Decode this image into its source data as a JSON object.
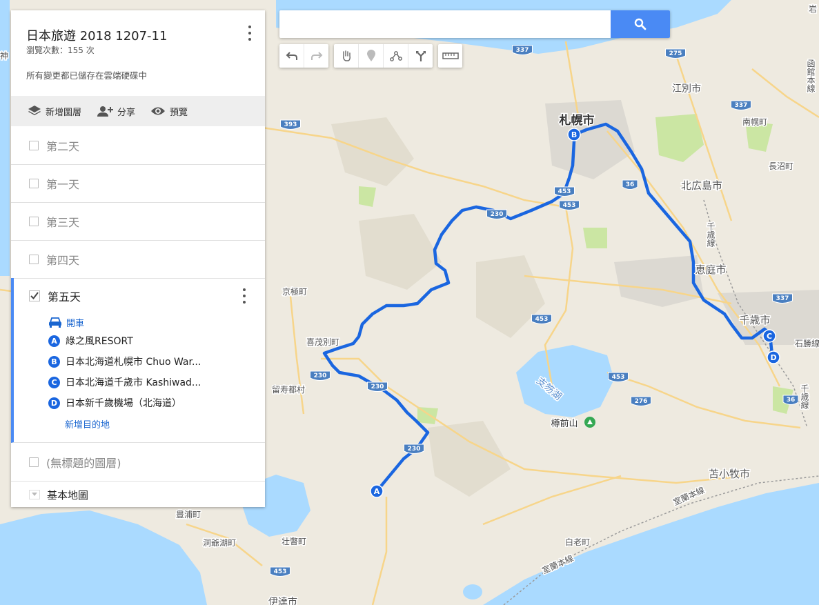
{
  "search": {
    "placeholder": "",
    "value": ""
  },
  "toolbar": {
    "tools": [
      {
        "icon": "undo-icon"
      },
      {
        "icon": "redo-icon"
      },
      {
        "icon": "hand-icon"
      },
      {
        "icon": "marker-icon"
      },
      {
        "icon": "draw-line-icon"
      },
      {
        "icon": "directions-icon"
      },
      {
        "icon": "ruler-icon"
      }
    ]
  },
  "panel": {
    "title": "日本旅遊 2018 1207-11",
    "view_count": "瀏覽次數：155 次",
    "save_status": "所有變更都已儲存在雲端硬碟中",
    "actions": {
      "add_layer": "新增圖層",
      "share": "分享",
      "preview": "預覽"
    },
    "layers": [
      {
        "name": "第二天",
        "checked": false
      },
      {
        "name": "第一天",
        "checked": false
      },
      {
        "name": "第三天",
        "checked": false
      },
      {
        "name": "第四天",
        "checked": false
      }
    ],
    "active_layer": {
      "name": "第五天",
      "checked": true,
      "mode": "開車",
      "destinations": [
        {
          "letter": "A",
          "name": "綠之風RESORT"
        },
        {
          "letter": "B",
          "name": "日本北海道札幌市 Chuo War..."
        },
        {
          "letter": "C",
          "name": "日本北海道千歲市 Kashiwad..."
        },
        {
          "letter": "D",
          "name": "日本新千歲機場（北海道）"
        }
      ],
      "add_destination": "新增目的地"
    },
    "untitled_layer": {
      "name": "(無標題的圖層)",
      "checked": false
    },
    "basemap": "基本地圖"
  },
  "map": {
    "route_color": "#1a66e0",
    "water_color": "#aadaff",
    "land_color": "#eeeae0",
    "green_color": "#cbe6a3",
    "place_labels": [
      {
        "id": "sapporo",
        "text": "札幌市"
      },
      {
        "id": "ebetsu",
        "text": "江別市"
      },
      {
        "id": "nanporo",
        "text": "南幌町"
      },
      {
        "id": "naganuma",
        "text": "長沼町"
      },
      {
        "id": "kitahiroshima",
        "text": "北広島市"
      },
      {
        "id": "eniwa",
        "text": "恵庭市"
      },
      {
        "id": "chitose",
        "text": "千歳市"
      },
      {
        "id": "ishikari",
        "text": "石勝線"
      },
      {
        "id": "kyogoku",
        "text": "京極町"
      },
      {
        "id": "kimobetsu",
        "text": "喜茂別町"
      },
      {
        "id": "rusutsu",
        "text": "留寿都村"
      },
      {
        "id": "shikotsu",
        "text": "支笏湖"
      },
      {
        "id": "tarumae",
        "text": "樽前山"
      },
      {
        "id": "tomakomai",
        "text": "苫小牧市"
      },
      {
        "id": "muroran1",
        "text": "室蘭本線"
      },
      {
        "id": "muroran2",
        "text": "室蘭本線"
      },
      {
        "id": "shiraoi",
        "text": "白老町"
      },
      {
        "id": "toyoura",
        "text": "豊浦町"
      },
      {
        "id": "toya",
        "text": "洞爺湖町"
      },
      {
        "id": "sobetsu",
        "text": "壮瞥町"
      },
      {
        "id": "chitose_line",
        "text": "千歳線"
      },
      {
        "id": "chitose_line2",
        "text": "千歳線"
      },
      {
        "id": "date",
        "text": "伊達市"
      },
      {
        "id": "iwami",
        "text": "岩"
      },
      {
        "id": "kami",
        "text": "神"
      },
      {
        "id": "hakodate",
        "text": "函館本線"
      }
    ],
    "route_shields": [
      {
        "id": "r393",
        "text": "393"
      },
      {
        "id": "r337a",
        "text": "337"
      },
      {
        "id": "r275",
        "text": "275"
      },
      {
        "id": "r337b",
        "text": "337"
      },
      {
        "id": "r337c",
        "text": "337"
      },
      {
        "id": "r36a",
        "text": "36"
      },
      {
        "id": "r36b",
        "text": "36"
      },
      {
        "id": "r453a",
        "text": "453"
      },
      {
        "id": "r453b",
        "text": "453"
      },
      {
        "id": "r453c",
        "text": "453"
      },
      {
        "id": "r453d",
        "text": "453"
      },
      {
        "id": "r230a",
        "text": "230"
      },
      {
        "id": "r230b",
        "text": "230"
      },
      {
        "id": "r276",
        "text": "276"
      },
      {
        "id": "r230c",
        "text": "230"
      },
      {
        "id": "r230d",
        "text": "230"
      },
      {
        "id": "r453e",
        "text": "453"
      }
    ]
  }
}
